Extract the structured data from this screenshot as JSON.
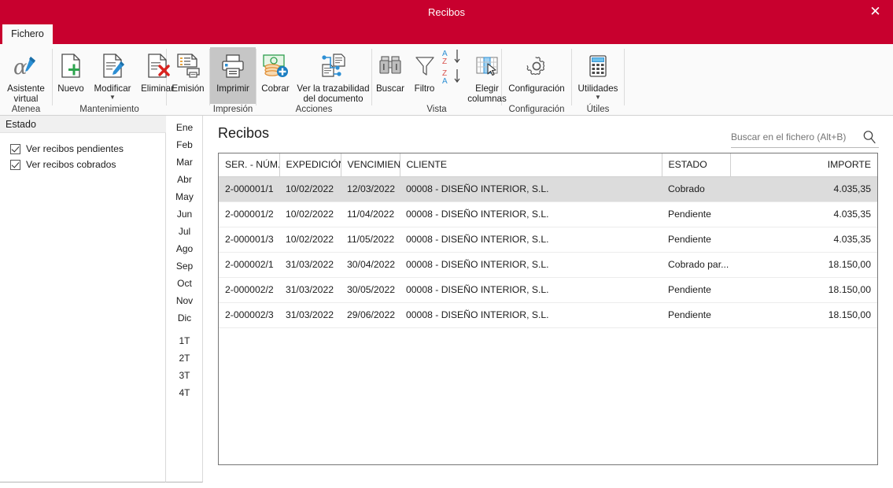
{
  "window": {
    "title": "Recibos",
    "close_label": "✕"
  },
  "tabs": [
    {
      "label": "Fichero",
      "active": true
    }
  ],
  "ribbon": {
    "groups": [
      {
        "name": "atenea",
        "label": "Atenea",
        "buttons": [
          {
            "name": "asistente-virtual",
            "label": "Asistente\nvirtual",
            "icon": "alpha-pen-icon",
            "caret": false,
            "active": false
          }
        ]
      },
      {
        "name": "mantenimiento",
        "label": "Mantenimiento",
        "buttons": [
          {
            "name": "nuevo",
            "label": "Nuevo",
            "icon": "document-plus-icon",
            "caret": false,
            "active": false
          },
          {
            "name": "modificar",
            "label": "Modificar",
            "icon": "document-pencil-icon",
            "caret": true,
            "active": false
          },
          {
            "name": "eliminar",
            "label": "Eliminar",
            "icon": "document-delete-icon",
            "caret": false,
            "active": false
          }
        ]
      },
      {
        "name": "emision-group",
        "label": "",
        "buttons": [
          {
            "name": "emision",
            "label": "Emisión",
            "icon": "document-print-icon",
            "caret": false,
            "active": false
          }
        ]
      },
      {
        "name": "impresion",
        "label": "Impresión",
        "buttons": [
          {
            "name": "imprimir",
            "label": "Imprimir",
            "icon": "printer-icon",
            "caret": false,
            "active": true
          }
        ]
      },
      {
        "name": "acciones",
        "label": "Acciones",
        "buttons": [
          {
            "name": "cobrar",
            "label": "Cobrar",
            "icon": "money-coins-plus-icon",
            "caret": false,
            "active": false
          },
          {
            "name": "ver-trazabilidad",
            "label": "Ver la trazabilidad\ndel documento",
            "icon": "traceability-icon",
            "caret": false,
            "active": false
          }
        ]
      },
      {
        "name": "vista",
        "label": "Vista",
        "buttons": [
          {
            "name": "buscar",
            "label": "Buscar",
            "icon": "binoculars-icon",
            "caret": false,
            "active": false
          },
          {
            "name": "filtro",
            "label": "Filtro",
            "icon": "funnel-icon",
            "caret": false,
            "active": false
          },
          {
            "name": "ordenar",
            "label": "",
            "icon": "sort-az-za-icon",
            "caret": false,
            "active": false
          },
          {
            "name": "elegir-columnas",
            "label": "Elegir\ncolumnas",
            "icon": "choose-columns-icon",
            "caret": false,
            "active": false
          }
        ]
      },
      {
        "name": "configuracion",
        "label": "Configuración",
        "buttons": [
          {
            "name": "configuracion",
            "label": "Configuración",
            "icon": "gear-icon",
            "caret": false,
            "active": false
          }
        ]
      },
      {
        "name": "utiles",
        "label": "Útiles",
        "buttons": [
          {
            "name": "utilidades",
            "label": "Utilidades",
            "icon": "calculator-icon",
            "caret": true,
            "active": false
          }
        ]
      }
    ]
  },
  "left_panel": {
    "header": "Estado",
    "checkboxes": [
      {
        "label": "Ver recibos pendientes",
        "checked": true
      },
      {
        "label": "Ver recibos cobrados",
        "checked": true
      }
    ]
  },
  "month_strip": {
    "months": [
      "Ene",
      "Feb",
      "Mar",
      "Abr",
      "May",
      "Jun",
      "Jul",
      "Ago",
      "Sep",
      "Oct",
      "Nov",
      "Dic"
    ],
    "quarters": [
      "1T",
      "2T",
      "3T",
      "4T"
    ]
  },
  "main": {
    "page_title": "Recibos",
    "search": {
      "placeholder": "Buscar en el fichero (Alt+B)",
      "value": ""
    },
    "table": {
      "columns": [
        {
          "key": "ser_num",
          "label": "SER. - NÚM.",
          "align": "left"
        },
        {
          "key": "expedicion",
          "label": "EXPEDICIÓN",
          "align": "left"
        },
        {
          "key": "vencimiento",
          "label": "VENCIMIEN...",
          "align": "left"
        },
        {
          "key": "cliente",
          "label": "CLIENTE",
          "align": "left"
        },
        {
          "key": "estado",
          "label": "ESTADO",
          "align": "left"
        },
        {
          "key": "importe",
          "label": "IMPORTE",
          "align": "right"
        }
      ],
      "rows": [
        {
          "ser_num": "2-000001/1",
          "expedicion": "10/02/2022",
          "vencimiento": "12/03/2022",
          "cliente": "00008 - DISEÑO INTERIOR, S.L.",
          "estado": "Cobrado",
          "importe": "4.035,35",
          "selected": true
        },
        {
          "ser_num": "2-000001/2",
          "expedicion": "10/02/2022",
          "vencimiento": "11/04/2022",
          "cliente": "00008 - DISEÑO INTERIOR, S.L.",
          "estado": "Pendiente",
          "importe": "4.035,35",
          "selected": false
        },
        {
          "ser_num": "2-000001/3",
          "expedicion": "10/02/2022",
          "vencimiento": "11/05/2022",
          "cliente": "00008 - DISEÑO INTERIOR, S.L.",
          "estado": "Pendiente",
          "importe": "4.035,35",
          "selected": false
        },
        {
          "ser_num": "2-000002/1",
          "expedicion": "31/03/2022",
          "vencimiento": "30/04/2022",
          "cliente": "00008 - DISEÑO INTERIOR, S.L.",
          "estado": "Cobrado par...",
          "importe": "18.150,00",
          "selected": false
        },
        {
          "ser_num": "2-000002/2",
          "expedicion": "31/03/2022",
          "vencimiento": "30/05/2022",
          "cliente": "00008 - DISEÑO INTERIOR, S.L.",
          "estado": "Pendiente",
          "importe": "18.150,00",
          "selected": false
        },
        {
          "ser_num": "2-000002/3",
          "expedicion": "31/03/2022",
          "vencimiento": "29/06/2022",
          "cliente": "00008 - DISEÑO INTERIOR, S.L.",
          "estado": "Pendiente",
          "importe": "18.150,00",
          "selected": false
        }
      ]
    }
  },
  "colors": {
    "brand_red": "#c8002e",
    "selected_row": "#dcdcdc",
    "ribbon_bg": "#fafafa",
    "active_button": "#c6c6c6"
  }
}
